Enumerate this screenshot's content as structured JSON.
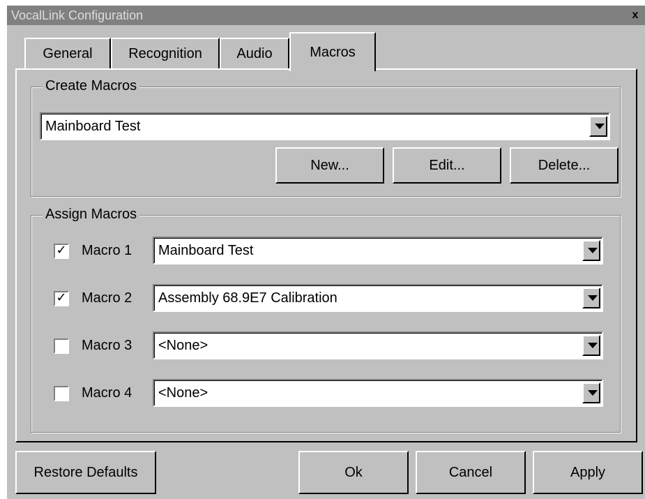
{
  "window": {
    "title": "VocalLink Configuration",
    "close_glyph": "x"
  },
  "tabs": [
    {
      "label": "General",
      "active": false
    },
    {
      "label": "Recognition",
      "active": false
    },
    {
      "label": "Audio",
      "active": false
    },
    {
      "label": "Macros",
      "active": true
    }
  ],
  "create_macros": {
    "legend": "Create Macros",
    "selected": "Mainboard Test",
    "new_label": "New...",
    "edit_label": "Edit...",
    "delete_label": "Delete..."
  },
  "assign_macros": {
    "legend": "Assign Macros",
    "rows": [
      {
        "label": "Macro 1",
        "checked": true,
        "check_glyph": "✓",
        "value": "Mainboard Test"
      },
      {
        "label": "Macro 2",
        "checked": true,
        "check_glyph": "✓",
        "value": "Assembly 68.9E7 Calibration"
      },
      {
        "label": "Macro 3",
        "checked": false,
        "check_glyph": "",
        "value": "<None>"
      },
      {
        "label": "Macro 4",
        "checked": false,
        "check_glyph": "",
        "value": "<None>"
      }
    ]
  },
  "footer": {
    "restore_label": "Restore Defaults",
    "ok_label": "Ok",
    "cancel_label": "Cancel",
    "apply_label": "Apply"
  }
}
